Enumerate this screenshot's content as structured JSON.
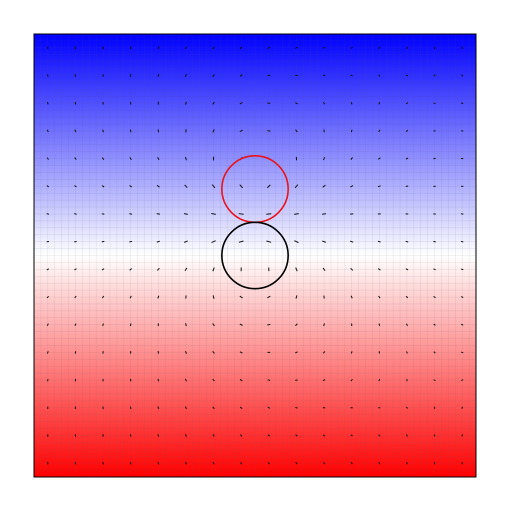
{
  "chart_data": {
    "type": "heatmap",
    "overlay": "vector-field",
    "title": "",
    "xlabel": "",
    "ylabel": "",
    "grid": true,
    "axes_ticks_shown": false,
    "color_scale": {
      "top": "#0000ff",
      "middle": "#ffffff",
      "bottom": "#ff0000"
    },
    "circles": [
      {
        "name": "red-circle",
        "color": "#e8141c",
        "cx": 0.0,
        "cy": 0.3,
        "r": 0.15
      },
      {
        "name": "black-circle",
        "color": "#000000",
        "cx": 0.0,
        "cy": 0.0,
        "r": 0.15
      }
    ],
    "domain": {
      "x": [
        -1,
        1
      ],
      "y": [
        -1,
        1
      ]
    },
    "field_grid": {
      "cols": 16,
      "rows": 16
    }
  }
}
